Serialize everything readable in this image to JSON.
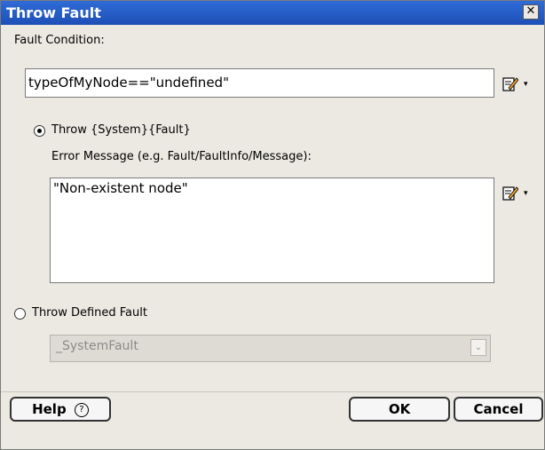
{
  "window": {
    "title": "Throw Fault",
    "close_glyph": "✕"
  },
  "fault_condition": {
    "label": "Fault Condition:",
    "value": "typeOfMyNode==\"undefined\""
  },
  "throw_system": {
    "label": "Throw {System}{Fault}",
    "selected": true
  },
  "error_message": {
    "label": "Error Message (e.g. Fault/FaultInfo/Message):",
    "value": "\"Non-existent node\""
  },
  "throw_defined": {
    "label": "Throw Defined Fault",
    "selected": false,
    "select_value": "_SystemFault"
  },
  "buttons": {
    "help": "Help",
    "help_glyph": "?",
    "ok": "OK",
    "cancel": "Cancel"
  },
  "icons": {
    "edit": "edit-pencil-icon",
    "menu_arrow": "▾",
    "dropdown_arrow": "⌄"
  }
}
